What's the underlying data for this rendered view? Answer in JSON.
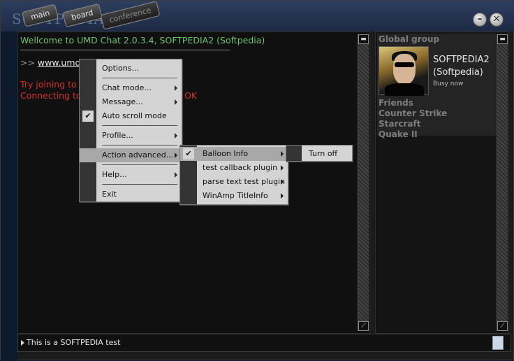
{
  "window": {
    "brand": "SOFTPEDIA",
    "tabs": [
      "main",
      "board",
      "conference"
    ]
  },
  "chat": {
    "welcome": "Wellcome to UMD Chat 2.0.3.4, ",
    "welcome_user": "SOFTPEDIA2 (Softpedia)",
    "link_prefix": ">> ",
    "link": "www.umdgr",
    "try_line": "Try joining to m",
    "connect_line": "Connecting to",
    "ok": "OK"
  },
  "panel": {
    "group_title": "Global group",
    "user_name": "SOFTPEDIA2",
    "user_sub": "(Softpedia)",
    "user_status": "Busy now",
    "groups": [
      "Friends",
      "Counter Strike",
      "Starcraft",
      "Quake II"
    ]
  },
  "input": {
    "text": "This is a SOFTPEDIA test"
  },
  "menu_main": {
    "items": [
      "Options...",
      "Chat mode...",
      "Message...",
      "Auto scroll mode",
      "Profile...",
      "Action advanced...",
      "Help...",
      "Exit"
    ]
  },
  "menu_action": {
    "items": [
      "Balloon Info",
      "test callback plugin",
      "parse text test plugin",
      "WinAmp TitleInfo"
    ]
  },
  "menu_balloon": {
    "items": [
      "Turn off"
    ]
  }
}
